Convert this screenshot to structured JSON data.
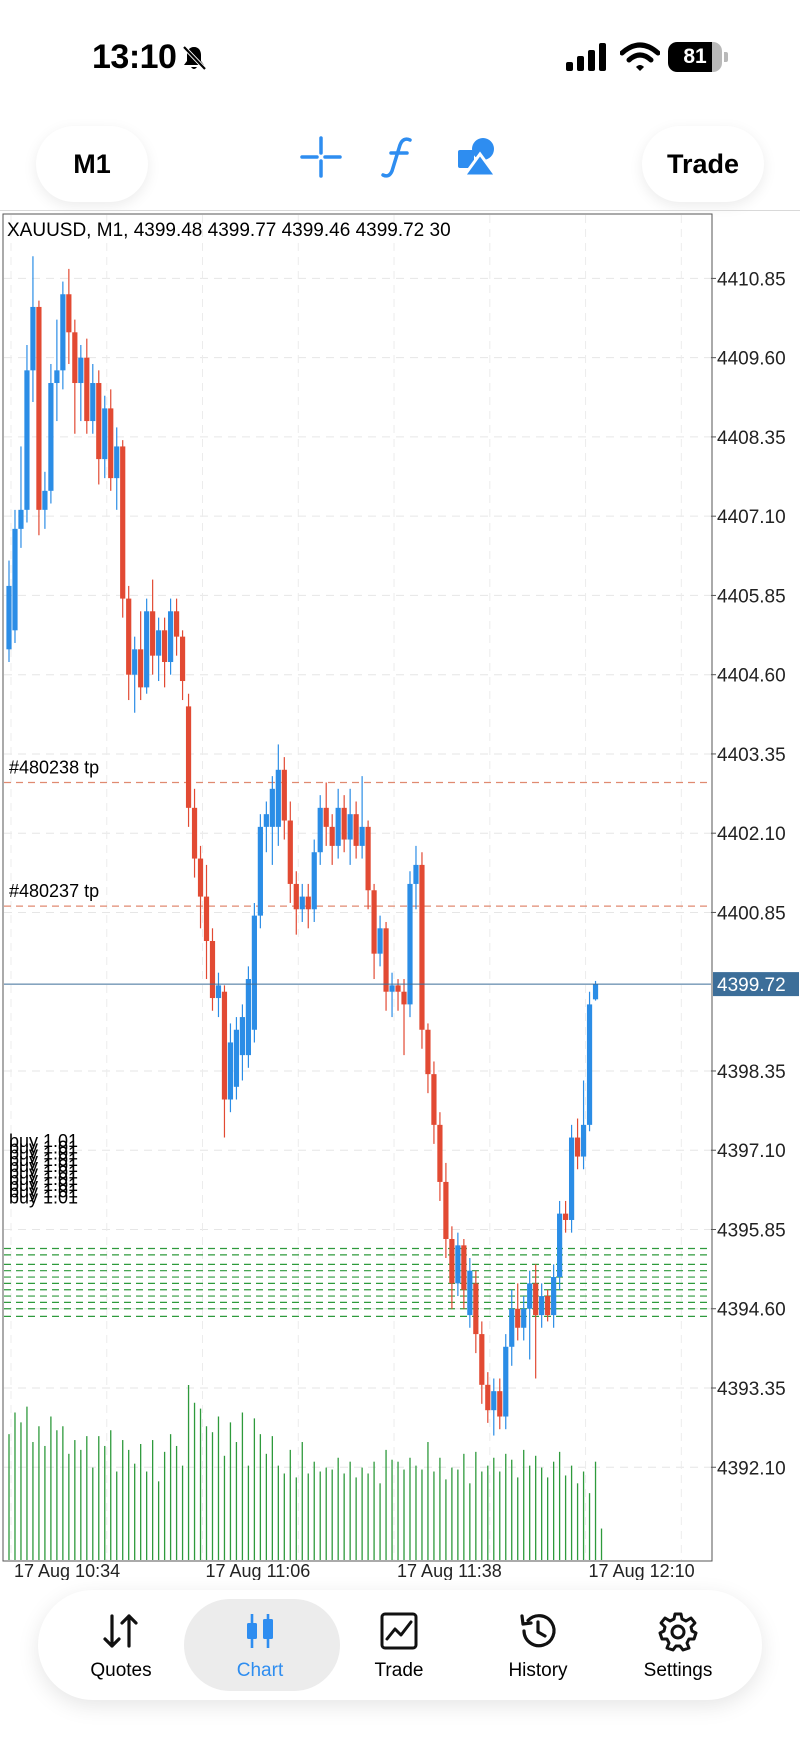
{
  "status_bar": {
    "time": "13:10",
    "battery": "81",
    "battery_level": 0.81
  },
  "toolbar": {
    "timeframe": "M1",
    "trade": "Trade"
  },
  "chart": {
    "header": "XAUUSD, M1, 4399.48 4399.77 4399.46 4399.72 30",
    "bid_price": "4399.72",
    "order_labels": [
      {
        "text": "#480238 tp",
        "price": 4402.9
      },
      {
        "text": "#480237 tp",
        "price": 4400.95
      }
    ],
    "buy_labels": [
      "buy 1.01",
      "buy 1.01",
      "buy 1.01",
      "buy 1.01",
      "buy 1.01",
      "buy 1.01",
      "buy 1.01",
      "buy 1.01",
      "buy 1.01",
      "buy 1.01"
    ],
    "buy_levels": [
      4395.55,
      4395.45,
      4395.3,
      4395.2,
      4395.1,
      4395.0,
      4394.9,
      4394.8,
      4394.7,
      4394.6,
      4394.48
    ],
    "colors": {
      "up": "#2b8de6",
      "down": "#e24a33",
      "volume": "#2e9a3c",
      "tp_line": "#e08a70",
      "buy_line": "#2e9a3c",
      "bid": "#3c6e99"
    }
  },
  "nav": {
    "items": [
      {
        "label": "Quotes",
        "icon": "quotes-arrows-icon"
      },
      {
        "label": "Chart",
        "icon": "candlestick-chart-icon"
      },
      {
        "label": "Trade",
        "icon": "trade-chart-icon"
      },
      {
        "label": "History",
        "icon": "history-clock-icon"
      },
      {
        "label": "Settings",
        "icon": "settings-gear-icon"
      }
    ],
    "active": "Chart"
  },
  "chart_data": {
    "type": "candlestick",
    "symbol": "XAUUSD",
    "timeframe": "M1",
    "title": "XAUUSD, M1, 4399.48 4399.77 4399.46 4399.72 30",
    "ylim": [
      4391.0,
      4411.85
    ],
    "y_ticks": [
      "4410.85",
      "4409.60",
      "4408.35",
      "4407.10",
      "4405.85",
      "4404.60",
      "4403.35",
      "4402.10",
      "4400.85",
      "4398.35",
      "4397.10",
      "4395.85",
      "4394.60",
      "4393.35",
      "4392.10"
    ],
    "y_tick_values": [
      4410.85,
      4409.6,
      4408.35,
      4407.1,
      4405.85,
      4404.6,
      4403.35,
      4402.1,
      4400.85,
      4398.35,
      4397.1,
      4395.85,
      4394.6,
      4393.35,
      4392.1
    ],
    "x_ticks": [
      "17 Aug 10:34",
      "17 Aug 11:06",
      "17 Aug 11:38",
      "17 Aug 12:10"
    ],
    "x_tick_index": [
      0,
      32,
      64,
      96
    ],
    "grid": true,
    "candles": [
      {
        "o": 4405.0,
        "h": 4406.4,
        "l": 4404.8,
        "c": 4406.0
      },
      {
        "o": 4405.3,
        "h": 4407.2,
        "l": 4405.1,
        "c": 4406.9
      },
      {
        "o": 4406.9,
        "h": 4408.2,
        "l": 4406.6,
        "c": 4407.2
      },
      {
        "o": 4407.2,
        "h": 4409.8,
        "l": 4407.0,
        "c": 4409.4
      },
      {
        "o": 4409.4,
        "h": 4411.2,
        "l": 4408.9,
        "c": 4410.4
      },
      {
        "o": 4410.4,
        "h": 4410.5,
        "l": 4406.8,
        "c": 4407.2
      },
      {
        "o": 4407.2,
        "h": 4407.8,
        "l": 4406.9,
        "c": 4407.5
      },
      {
        "o": 4407.5,
        "h": 4409.5,
        "l": 4407.3,
        "c": 4409.2
      },
      {
        "o": 4409.2,
        "h": 4410.2,
        "l": 4408.6,
        "c": 4409.4
      },
      {
        "o": 4409.4,
        "h": 4410.8,
        "l": 4409.1,
        "c": 4410.6
      },
      {
        "o": 4410.6,
        "h": 4411.0,
        "l": 4409.5,
        "c": 4410.0
      },
      {
        "o": 4410.0,
        "h": 4410.2,
        "l": 4408.4,
        "c": 4409.2
      },
      {
        "o": 4409.2,
        "h": 4409.8,
        "l": 4408.6,
        "c": 4409.6
      },
      {
        "o": 4409.6,
        "h": 4409.9,
        "l": 4408.4,
        "c": 4408.6
      },
      {
        "o": 4408.6,
        "h": 4409.5,
        "l": 4408.4,
        "c": 4409.2
      },
      {
        "o": 4409.2,
        "h": 4409.4,
        "l": 4407.6,
        "c": 4408.0
      },
      {
        "o": 4408.0,
        "h": 4409.0,
        "l": 4407.7,
        "c": 4408.8
      },
      {
        "o": 4408.8,
        "h": 4409.1,
        "l": 4407.5,
        "c": 4407.7
      },
      {
        "o": 4407.7,
        "h": 4408.5,
        "l": 4407.2,
        "c": 4408.2
      },
      {
        "o": 4408.2,
        "h": 4408.3,
        "l": 4405.5,
        "c": 4405.8
      },
      {
        "o": 4405.8,
        "h": 4406.0,
        "l": 4404.2,
        "c": 4404.6
      },
      {
        "o": 4404.6,
        "h": 4405.2,
        "l": 4404.0,
        "c": 4405.0
      },
      {
        "o": 4405.0,
        "h": 4405.6,
        "l": 4404.2,
        "c": 4404.4
      },
      {
        "o": 4404.4,
        "h": 4405.8,
        "l": 4404.3,
        "c": 4405.6
      },
      {
        "o": 4405.6,
        "h": 4406.1,
        "l": 4404.6,
        "c": 4404.9
      },
      {
        "o": 4404.9,
        "h": 4405.5,
        "l": 4404.5,
        "c": 4405.3
      },
      {
        "o": 4405.3,
        "h": 4405.5,
        "l": 4404.4,
        "c": 4404.8
      },
      {
        "o": 4404.8,
        "h": 4405.8,
        "l": 4404.6,
        "c": 4405.6
      },
      {
        "o": 4405.6,
        "h": 4405.8,
        "l": 4404.9,
        "c": 4405.2
      },
      {
        "o": 4405.2,
        "h": 4405.3,
        "l": 4404.2,
        "c": 4404.5
      },
      {
        "o": 4404.1,
        "h": 4404.3,
        "l": 4402.2,
        "c": 4402.5
      },
      {
        "o": 4402.5,
        "h": 4402.8,
        "l": 4401.4,
        "c": 4401.7
      },
      {
        "o": 4401.7,
        "h": 4401.9,
        "l": 4400.6,
        "c": 4401.1
      },
      {
        "o": 4401.1,
        "h": 4401.6,
        "l": 4399.8,
        "c": 4400.4
      },
      {
        "o": 4400.4,
        "h": 4400.6,
        "l": 4399.3,
        "c": 4399.5
      },
      {
        "o": 4399.5,
        "h": 4399.9,
        "l": 4399.2,
        "c": 4399.7
      },
      {
        "o": 4399.6,
        "h": 4399.7,
        "l": 4397.3,
        "c": 4397.9
      },
      {
        "o": 4397.9,
        "h": 4399.1,
        "l": 4397.7,
        "c": 4398.8
      },
      {
        "o": 4398.1,
        "h": 4399.2,
        "l": 4397.9,
        "c": 4399.0
      },
      {
        "o": 4398.6,
        "h": 4399.4,
        "l": 4398.2,
        "c": 4399.2
      },
      {
        "o": 4398.6,
        "h": 4400.0,
        "l": 4398.4,
        "c": 4399.8
      },
      {
        "o": 4399.0,
        "h": 4401.0,
        "l": 4398.8,
        "c": 4400.8
      },
      {
        "o": 4400.8,
        "h": 4402.4,
        "l": 4400.6,
        "c": 4402.2
      },
      {
        "o": 4402.2,
        "h": 4402.6,
        "l": 4401.8,
        "c": 4402.4
      },
      {
        "o": 4402.2,
        "h": 4403.0,
        "l": 4401.6,
        "c": 4402.8
      },
      {
        "o": 4402.2,
        "h": 4403.5,
        "l": 4401.9,
        "c": 4403.1
      },
      {
        "o": 4403.1,
        "h": 4403.3,
        "l": 4402.0,
        "c": 4402.3
      },
      {
        "o": 4402.3,
        "h": 4402.6,
        "l": 4401.0,
        "c": 4401.3
      },
      {
        "o": 4401.3,
        "h": 4401.5,
        "l": 4400.5,
        "c": 4400.9
      },
      {
        "o": 4400.9,
        "h": 4401.3,
        "l": 4400.7,
        "c": 4401.1
      },
      {
        "o": 4401.1,
        "h": 4401.3,
        "l": 4400.6,
        "c": 4400.9
      },
      {
        "o": 4400.9,
        "h": 4402.0,
        "l": 4400.7,
        "c": 4401.8
      },
      {
        "o": 4401.8,
        "h": 4402.7,
        "l": 4401.6,
        "c": 4402.5
      },
      {
        "o": 4402.5,
        "h": 4402.9,
        "l": 4401.9,
        "c": 4402.2
      },
      {
        "o": 4402.2,
        "h": 4402.4,
        "l": 4401.6,
        "c": 4401.9
      },
      {
        "o": 4401.9,
        "h": 4402.8,
        "l": 4401.7,
        "c": 4402.5
      },
      {
        "o": 4402.5,
        "h": 4402.7,
        "l": 4401.8,
        "c": 4402.0
      },
      {
        "o": 4402.0,
        "h": 4402.8,
        "l": 4401.6,
        "c": 4402.4
      },
      {
        "o": 4402.4,
        "h": 4402.6,
        "l": 4401.7,
        "c": 4401.9
      },
      {
        "o": 4401.9,
        "h": 4403.0,
        "l": 4401.7,
        "c": 4402.2
      },
      {
        "o": 4402.2,
        "h": 4402.3,
        "l": 4400.9,
        "c": 4401.2
      },
      {
        "o": 4401.2,
        "h": 4401.3,
        "l": 4399.8,
        "c": 4400.2
      },
      {
        "o": 4400.2,
        "h": 4400.8,
        "l": 4400.0,
        "c": 4400.6
      },
      {
        "o": 4400.6,
        "h": 4400.7,
        "l": 4399.3,
        "c": 4399.6
      },
      {
        "o": 4399.6,
        "h": 4399.9,
        "l": 4399.2,
        "c": 4399.7
      },
      {
        "o": 4399.7,
        "h": 4399.8,
        "l": 4399.3,
        "c": 4399.6
      },
      {
        "o": 4399.6,
        "h": 4399.8,
        "l": 4398.6,
        "c": 4399.4
      },
      {
        "o": 4399.4,
        "h": 4401.5,
        "l": 4399.2,
        "c": 4401.3
      },
      {
        "o": 4401.3,
        "h": 4401.9,
        "l": 4400.9,
        "c": 4401.6
      },
      {
        "o": 4401.6,
        "h": 4401.8,
        "l": 4398.7,
        "c": 4399.0
      },
      {
        "o": 4399.0,
        "h": 4399.1,
        "l": 4398.0,
        "c": 4398.3
      },
      {
        "o": 4398.3,
        "h": 4398.5,
        "l": 4397.2,
        "c": 4397.5
      },
      {
        "o": 4397.5,
        "h": 4397.7,
        "l": 4396.3,
        "c": 4396.6
      },
      {
        "o": 4396.6,
        "h": 4396.9,
        "l": 4395.4,
        "c": 4395.7
      },
      {
        "o": 4395.7,
        "h": 4395.9,
        "l": 4394.6,
        "c": 4395.0
      },
      {
        "o": 4395.0,
        "h": 4395.8,
        "l": 4394.8,
        "c": 4395.6
      },
      {
        "o": 4395.6,
        "h": 4395.7,
        "l": 4394.6,
        "c": 4394.9
      },
      {
        "o": 4394.5,
        "h": 4395.4,
        "l": 4394.3,
        "c": 4395.2
      },
      {
        "o": 4395.0,
        "h": 4395.2,
        "l": 4393.9,
        "c": 4394.2
      },
      {
        "o": 4394.2,
        "h": 4394.4,
        "l": 4393.1,
        "c": 4393.4
      },
      {
        "o": 4393.4,
        "h": 4393.6,
        "l": 4392.8,
        "c": 4393.0
      },
      {
        "o": 4393.0,
        "h": 4393.5,
        "l": 4392.6,
        "c": 4393.3
      },
      {
        "o": 4393.3,
        "h": 4393.5,
        "l": 4392.7,
        "c": 4392.9
      },
      {
        "o": 4392.9,
        "h": 4394.2,
        "l": 4392.7,
        "c": 4394.0
      },
      {
        "o": 4394.0,
        "h": 4394.9,
        "l": 4393.7,
        "c": 4394.6
      },
      {
        "o": 4394.6,
        "h": 4395.0,
        "l": 4394.1,
        "c": 4394.3
      },
      {
        "o": 4394.3,
        "h": 4394.8,
        "l": 4394.1,
        "c": 4394.6
      },
      {
        "o": 4394.6,
        "h": 4395.2,
        "l": 4393.8,
        "c": 4395.0
      },
      {
        "o": 4395.0,
        "h": 4395.3,
        "l": 4393.5,
        "c": 4394.5
      },
      {
        "o": 4394.5,
        "h": 4395.0,
        "l": 4394.3,
        "c": 4394.8
      },
      {
        "o": 4394.8,
        "h": 4394.9,
        "l": 4394.4,
        "c": 4394.5
      },
      {
        "o": 4394.5,
        "h": 4395.3,
        "l": 4394.3,
        "c": 4395.1
      },
      {
        "o": 4395.1,
        "h": 4396.3,
        "l": 4394.9,
        "c": 4396.1
      },
      {
        "o": 4396.1,
        "h": 4396.3,
        "l": 4395.8,
        "c": 4396.0
      },
      {
        "o": 4396.0,
        "h": 4397.5,
        "l": 4395.8,
        "c": 4397.3
      },
      {
        "o": 4397.3,
        "h": 4397.6,
        "l": 4396.8,
        "c": 4397.0
      },
      {
        "o": 4397.0,
        "h": 4398.2,
        "l": 4396.8,
        "c": 4397.5
      },
      {
        "o": 4397.5,
        "h": 4399.6,
        "l": 4397.4,
        "c": 4399.4
      },
      {
        "o": 4399.48,
        "h": 4399.77,
        "l": 4399.46,
        "c": 4399.72
      }
    ],
    "volumes": [
      64,
      75,
      70,
      78,
      60,
      68,
      58,
      73,
      66,
      68,
      54,
      61,
      56,
      63,
      47,
      63,
      58,
      66,
      45,
      61,
      56,
      49,
      59,
      45,
      61,
      40,
      55,
      64,
      58,
      48,
      89,
      80,
      77,
      68,
      65,
      73,
      53,
      70,
      60,
      75,
      48,
      72,
      64,
      54,
      63,
      48,
      44,
      56,
      42,
      60,
      44,
      50,
      45,
      47,
      46,
      52,
      44,
      50,
      42,
      47,
      44,
      50,
      39,
      56,
      51,
      50,
      46,
      52,
      48,
      46,
      60,
      45,
      52,
      41,
      47,
      46,
      54,
      39,
      55,
      45,
      48,
      52,
      45,
      54,
      51,
      42,
      56,
      48,
      53,
      47,
      42,
      50,
      55,
      43,
      48,
      39,
      45,
      34,
      50,
      16
    ]
  }
}
